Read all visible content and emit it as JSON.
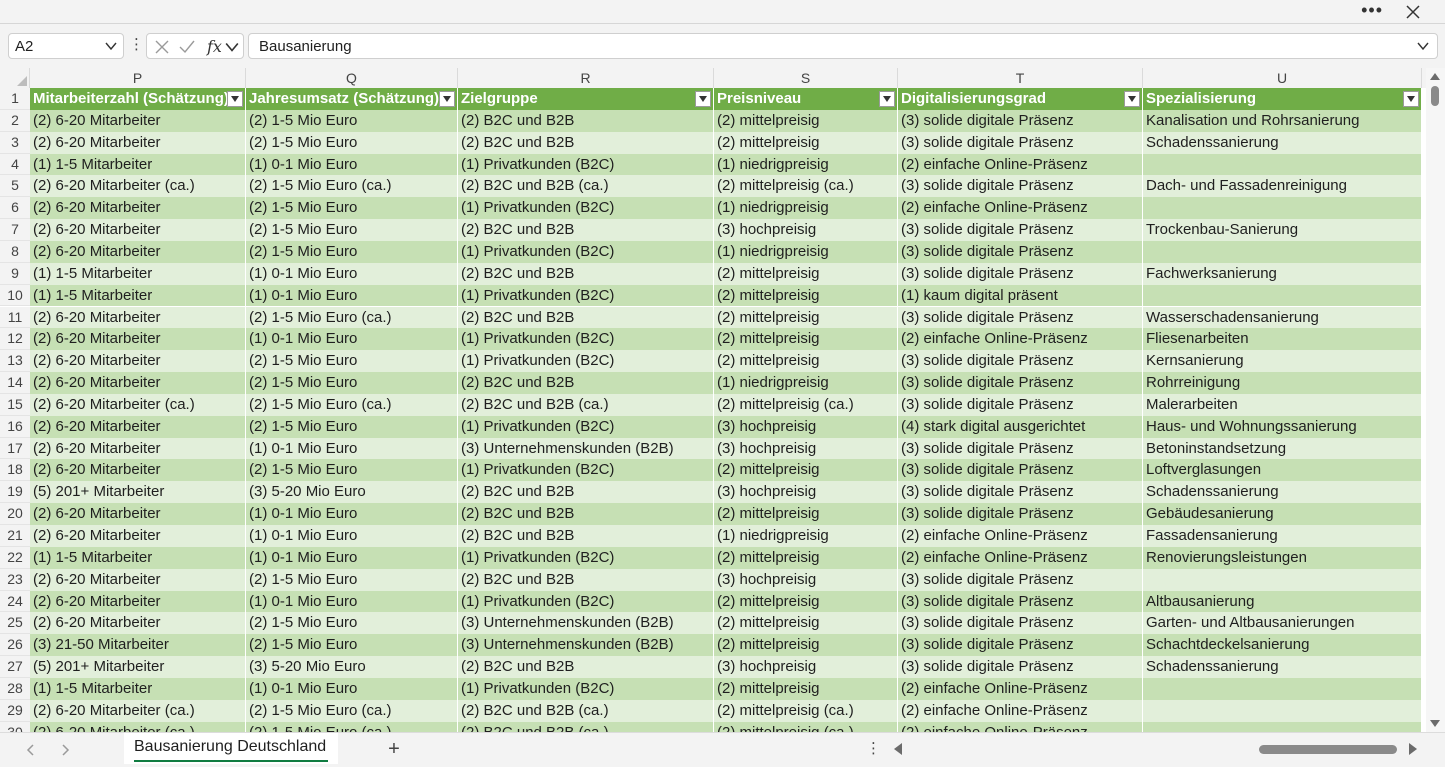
{
  "name_box": {
    "value": "A2"
  },
  "formula_bar": {
    "value": "Bausanierung",
    "fx": "fx"
  },
  "columns": [
    {
      "letter": "P",
      "header": "Mitarbeiterzahl (Schätzung)"
    },
    {
      "letter": "Q",
      "header": "Jahresumsatz (Schätzung)"
    },
    {
      "letter": "R",
      "header": "Zielgruppe"
    },
    {
      "letter": "S",
      "header": "Preisniveau"
    },
    {
      "letter": "T",
      "header": "Digitalisierungsgrad"
    },
    {
      "letter": "U",
      "header": "Spezialisierung"
    }
  ],
  "row_numbers": [
    "1",
    "2",
    "3",
    "4",
    "5",
    "6",
    "7",
    "8",
    "9",
    "10",
    "11",
    "12",
    "13",
    "14",
    "15",
    "16",
    "17",
    "18",
    "19",
    "20",
    "21",
    "22",
    "23",
    "24",
    "25",
    "26",
    "27",
    "28",
    "29",
    "30"
  ],
  "rows": [
    [
      "(2) 6-20 Mitarbeiter",
      "(2) 1-5 Mio Euro",
      "(2) B2C und B2B",
      "(2) mittelpreisig",
      "(3) solide digitale Präsenz",
      "Kanalisation und Rohrsanierung"
    ],
    [
      "(2) 6-20 Mitarbeiter",
      "(2) 1-5 Mio Euro",
      "(2) B2C und B2B",
      "(2) mittelpreisig",
      "(3) solide digitale Präsenz",
      "Schadenssanierung"
    ],
    [
      "(1) 1-5 Mitarbeiter",
      "(1) 0-1 Mio Euro",
      "(1) Privatkunden (B2C)",
      "(1) niedrigpreisig",
      "(2) einfache Online-Präsenz",
      ""
    ],
    [
      "(2) 6-20 Mitarbeiter (ca.)",
      "(2) 1-5 Mio Euro (ca.)",
      "(2) B2C und B2B (ca.)",
      "(2) mittelpreisig (ca.)",
      "(3) solide digitale Präsenz",
      "Dach- und Fassadenreinigung"
    ],
    [
      "(2) 6-20 Mitarbeiter",
      "(2) 1-5 Mio Euro",
      "(1) Privatkunden (B2C)",
      "(1) niedrigpreisig",
      "(2) einfache Online-Präsenz",
      ""
    ],
    [
      "(2) 6-20 Mitarbeiter",
      "(2) 1-5 Mio Euro",
      "(2) B2C und B2B",
      "(3) hochpreisig",
      "(3) solide digitale Präsenz",
      "Trockenbau-Sanierung"
    ],
    [
      "(2) 6-20 Mitarbeiter",
      "(2) 1-5 Mio Euro",
      "(1) Privatkunden (B2C)",
      "(1) niedrigpreisig",
      "(3) solide digitale Präsenz",
      ""
    ],
    [
      "(1) 1-5 Mitarbeiter",
      "(1) 0-1 Mio Euro",
      "(2) B2C und B2B",
      "(2) mittelpreisig",
      "(3) solide digitale Präsenz",
      "Fachwerksanierung"
    ],
    [
      "(1) 1-5 Mitarbeiter",
      "(1) 0-1 Mio Euro",
      "(1) Privatkunden (B2C)",
      "(2) mittelpreisig",
      "(1) kaum digital präsent",
      ""
    ],
    [
      "(2) 6-20 Mitarbeiter",
      "(2) 1-5 Mio Euro (ca.)",
      "(2) B2C und B2B",
      "(2) mittelpreisig",
      "(3) solide digitale Präsenz",
      "Wasserschadensanierung"
    ],
    [
      "(2) 6-20 Mitarbeiter",
      "(1) 0-1 Mio Euro",
      "(1) Privatkunden (B2C)",
      "(2) mittelpreisig",
      "(2) einfache Online-Präsenz",
      "Fliesenarbeiten"
    ],
    [
      "(2) 6-20 Mitarbeiter",
      "(2) 1-5 Mio Euro",
      "(1) Privatkunden (B2C)",
      "(2) mittelpreisig",
      "(3) solide digitale Präsenz",
      "Kernsanierung"
    ],
    [
      "(2) 6-20 Mitarbeiter",
      "(2) 1-5 Mio Euro",
      "(2) B2C und B2B",
      "(1) niedrigpreisig",
      "(3) solide digitale Präsenz",
      "Rohrreinigung"
    ],
    [
      "(2) 6-20 Mitarbeiter (ca.)",
      "(2) 1-5 Mio Euro (ca.)",
      "(2) B2C und B2B (ca.)",
      "(2) mittelpreisig (ca.)",
      "(3) solide digitale Präsenz",
      "Malerarbeiten"
    ],
    [
      "(2) 6-20 Mitarbeiter",
      "(2) 1-5 Mio Euro",
      "(1) Privatkunden (B2C)",
      "(3) hochpreisig",
      "(4) stark digital ausgerichtet",
      "Haus- und Wohnungssanierung"
    ],
    [
      "(2) 6-20 Mitarbeiter",
      "(1) 0-1 Mio Euro",
      "(3) Unternehmenskunden (B2B)",
      "(3) hochpreisig",
      "(3) solide digitale Präsenz",
      "Betoninstandsetzung"
    ],
    [
      "(2) 6-20 Mitarbeiter",
      "(2) 1-5 Mio Euro",
      "(1) Privatkunden (B2C)",
      "(2) mittelpreisig",
      "(3) solide digitale Präsenz",
      "Loftverglasungen"
    ],
    [
      "(5) 201+ Mitarbeiter",
      "(3) 5-20 Mio Euro",
      "(2) B2C und B2B",
      "(3) hochpreisig",
      "(3) solide digitale Präsenz",
      "Schadenssanierung"
    ],
    [
      "(2) 6-20 Mitarbeiter",
      "(1) 0-1 Mio Euro",
      "(2) B2C und B2B",
      "(2) mittelpreisig",
      "(3) solide digitale Präsenz",
      "Gebäudesanierung"
    ],
    [
      "(2) 6-20 Mitarbeiter",
      "(1) 0-1 Mio Euro",
      "(2) B2C und B2B",
      "(1) niedrigpreisig",
      "(2) einfache Online-Präsenz",
      "Fassadensanierung"
    ],
    [
      "(1) 1-5 Mitarbeiter",
      "(1) 0-1 Mio Euro",
      "(1) Privatkunden (B2C)",
      "(2) mittelpreisig",
      "(2) einfache Online-Präsenz",
      "Renovierungsleistungen"
    ],
    [
      "(2) 6-20 Mitarbeiter",
      "(2) 1-5 Mio Euro",
      "(2) B2C und B2B",
      "(3) hochpreisig",
      "(3) solide digitale Präsenz",
      ""
    ],
    [
      "(2) 6-20 Mitarbeiter",
      "(1) 0-1 Mio Euro",
      "(1) Privatkunden (B2C)",
      "(2) mittelpreisig",
      "(3) solide digitale Präsenz",
      "Altbausanierung"
    ],
    [
      "(2) 6-20 Mitarbeiter",
      "(2) 1-5 Mio Euro",
      "(3) Unternehmenskunden (B2B)",
      "(2) mittelpreisig",
      "(3) solide digitale Präsenz",
      "Garten- und Altbausanierungen"
    ],
    [
      "(3) 21-50 Mitarbeiter",
      "(2) 1-5 Mio Euro",
      "(3) Unternehmenskunden (B2B)",
      "(2) mittelpreisig",
      "(3) solide digitale Präsenz",
      "Schachtdeckelsanierung"
    ],
    [
      "(5) 201+ Mitarbeiter",
      "(3) 5-20 Mio Euro",
      "(2) B2C und B2B",
      "(3) hochpreisig",
      "(3) solide digitale Präsenz",
      "Schadenssanierung"
    ],
    [
      "(1) 1-5 Mitarbeiter",
      "(1) 0-1 Mio Euro",
      "(1) Privatkunden (B2C)",
      "(2) mittelpreisig",
      "(2) einfache Online-Präsenz",
      ""
    ],
    [
      "(2) 6-20 Mitarbeiter (ca.)",
      "(2) 1-5 Mio Euro (ca.)",
      "(2) B2C und B2B (ca.)",
      "(2) mittelpreisig (ca.)",
      "(2) einfache Online-Präsenz",
      ""
    ],
    [
      "(2) 6-20 Mitarbeiter (ca.)",
      "(2) 1-5 Mio Euro (ca.)",
      "(2) B2C und B2B (ca.)",
      "(2) mittelpreisig (ca.)",
      "(2) einfache Online-Präsenz",
      ""
    ]
  ],
  "sheet_tab": {
    "label": "Bausanierung Deutschland",
    "add_label": "+"
  },
  "colors": {
    "header_green": "#70ad47",
    "band_dark": "#c6e0b4",
    "band_light": "#e2efda",
    "accent": "#107c41"
  }
}
